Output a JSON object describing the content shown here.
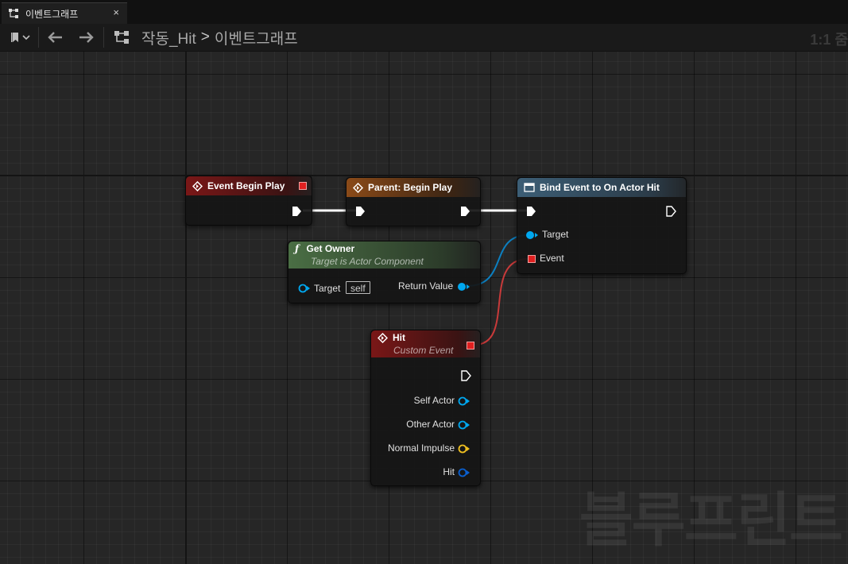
{
  "tab": {
    "label": "이벤트그래프",
    "close": "×",
    "icon": "graph-icon"
  },
  "toolbar": {
    "breadcrumb_root": "작동_Hit",
    "breadcrumb_separator": ">",
    "breadcrumb_current": "이벤트그래프",
    "zoom": "1:1 줌",
    "icons": [
      "bookmark-icon",
      "chevron-down-icon",
      "back-arrow-icon",
      "forward-arrow-icon",
      "graph-icon"
    ]
  },
  "watermark": "블루프린트",
  "nodes": {
    "event_begin_play": {
      "title": "Event Begin Play"
    },
    "parent_begin_play": {
      "title": "Parent: Begin Play"
    },
    "bind_event": {
      "title": "Bind Event to On Actor Hit",
      "pins": {
        "target": "Target",
        "event": "Event"
      }
    },
    "get_owner": {
      "icon": "ƒ",
      "title": "Get Owner",
      "subtitle": "Target is Actor Component",
      "pins": {
        "target": "Target",
        "target_value": "self",
        "return_value": "Return Value"
      }
    },
    "hit": {
      "title": "Hit",
      "subtitle": "Custom Event",
      "pins": {
        "self_actor": "Self Actor",
        "other_actor": "Other Actor",
        "normal_impulse": "Normal Impulse",
        "hit": "Hit"
      }
    }
  },
  "colors": {
    "exec": "#ffffff",
    "object_pin": "#00a8f0",
    "delegate_pin": "#ff3838",
    "vector_pin": "#f0c020",
    "struct_pin": "#0a5fd0",
    "event_header": "#7a1717",
    "parent_header": "#8a4a18",
    "function_header": "#4a6e44",
    "bind_header": "#3c5e76"
  }
}
